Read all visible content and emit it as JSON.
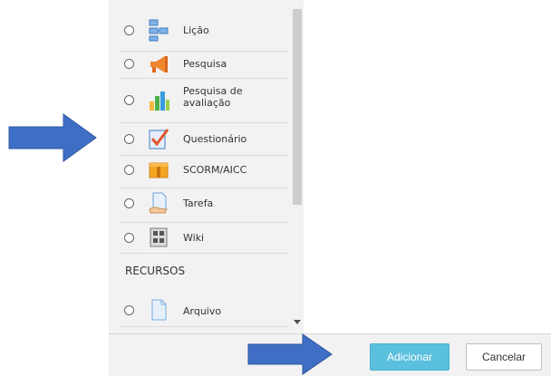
{
  "activities": [
    {
      "label": "Lição",
      "icon": "lesson-icon"
    },
    {
      "label": "Pesquisa",
      "icon": "megaphone-icon"
    },
    {
      "label": "Pesquisa de avaliação",
      "icon": "bar-chart-icon"
    },
    {
      "label": "Questionário",
      "icon": "quiz-checkmark-icon"
    },
    {
      "label": "SCORM/AICC",
      "icon": "package-icon"
    },
    {
      "label": "Tarefa",
      "icon": "assignment-icon"
    },
    {
      "label": "Wiki",
      "icon": "wiki-icon"
    }
  ],
  "resources_section": "RECURSOS",
  "resources": [
    {
      "label": "Arquivo",
      "icon": "file-icon"
    }
  ],
  "footer": {
    "add_label": "Adicionar",
    "cancel_label": "Cancelar"
  },
  "colors": {
    "accent": "#5bc0de",
    "arrow": "#3e6fc4",
    "panel_bg": "#f2f2f2"
  }
}
